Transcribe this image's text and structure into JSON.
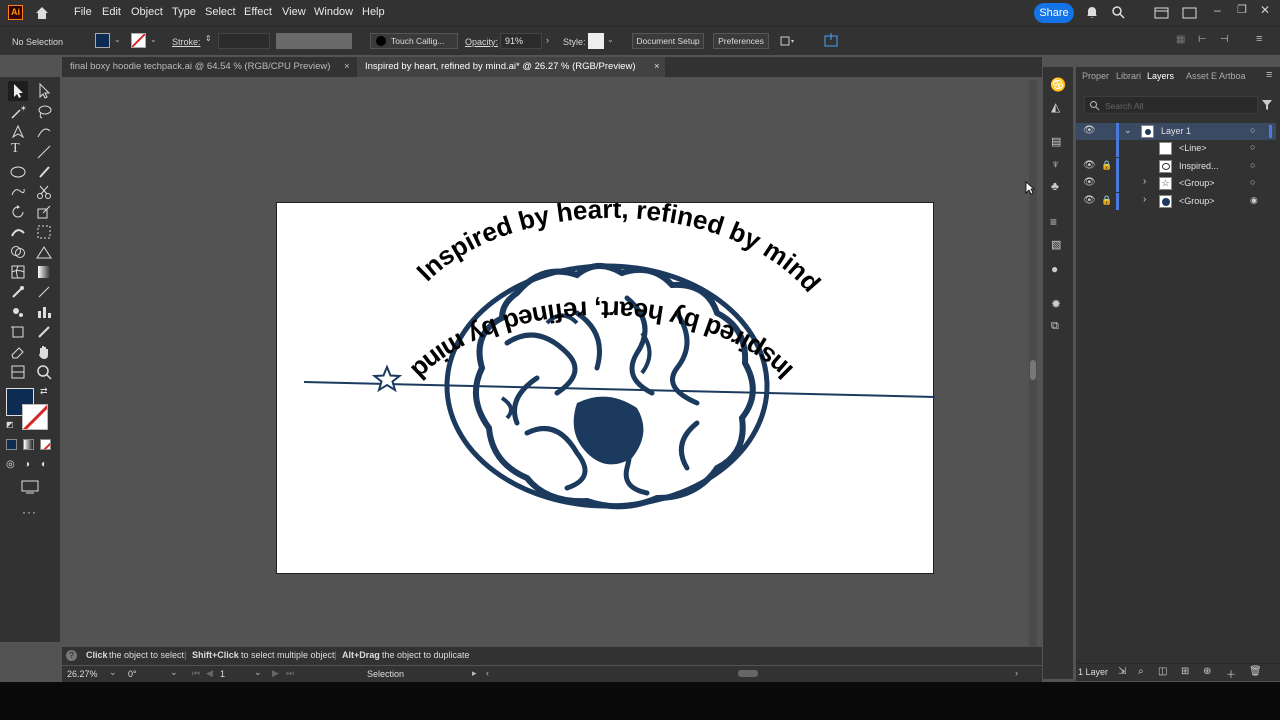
{
  "app": {
    "logo": "Ai"
  },
  "menu": {
    "items": [
      "File",
      "Edit",
      "Object",
      "Type",
      "Select",
      "Effect",
      "View",
      "Window",
      "Help"
    ],
    "share_label": "Share"
  },
  "control": {
    "selection_label": "No Selection",
    "stroke_label": "Stroke:",
    "brush_label": "Touch Callig...",
    "opacity_label": "Opacity:",
    "opacity_value": "91%",
    "style_label": "Style:",
    "doc_setup_label": "Document Setup",
    "preferences_label": "Preferences"
  },
  "tabs": [
    {
      "label": "final boxy hoodie techpack.ai @ 64.54 % (RGB/CPU Preview)"
    },
    {
      "label": "Inspired by heart, refined by mind.ai* @ 26.27 % (RGB/Preview)"
    }
  ],
  "artwork": {
    "top_text": "Inspired by heart, refined by mind",
    "bottom_text": "Inspired by heart, refined by mind",
    "color": "#1c3a5e"
  },
  "panel": {
    "tabs": [
      "Proper",
      "Librari",
      "Layers",
      "Asset E",
      "Artboa"
    ],
    "search_placeholder": "Search All",
    "layers": [
      {
        "name": "Layer 1"
      },
      {
        "name": "<Line>"
      },
      {
        "name": "Inspired..."
      },
      {
        "name": "<Group>"
      },
      {
        "name": "<Group>"
      }
    ],
    "layer_count": "1 Layer"
  },
  "status": {
    "hint_click": "Click",
    "hint_click_text": "the object to select",
    "hint_shift": "Shift+Click",
    "hint_shift_text": "to select multiple object",
    "hint_alt": "Alt+Drag",
    "hint_alt_text": "the object to duplicate",
    "zoom": "26.27%",
    "rotation": "0°",
    "artboard_num": "1",
    "tool": "Selection"
  },
  "colors": {
    "accent": "#1473e6",
    "fill": "#0d2c54",
    "stroke": "#d62828"
  }
}
